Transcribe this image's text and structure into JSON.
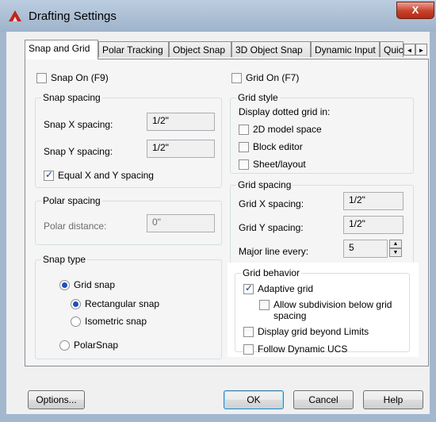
{
  "window": {
    "title": "Drafting Settings",
    "close_glyph": "X",
    "app_icon": "autocad-red-a-icon"
  },
  "tabs": [
    {
      "label": "Snap and Grid"
    },
    {
      "label": "Polar Tracking"
    },
    {
      "label": "Object Snap"
    },
    {
      "label": "3D Object Snap"
    },
    {
      "label": "Dynamic Input"
    },
    {
      "label": "Quic"
    }
  ],
  "tab_scroll": {
    "left": "◄",
    "right": "►"
  },
  "snap_on": {
    "label": "Snap On (F9)",
    "checked": false
  },
  "grid_on": {
    "label": "Grid On (F7)",
    "checked": false
  },
  "snap_spacing": {
    "title": "Snap spacing",
    "x_label": "Snap X spacing:",
    "x_value": "1/2\"",
    "y_label": "Snap Y spacing:",
    "y_value": "1/2\"",
    "equal_label": "Equal X and Y spacing",
    "equal_checked": true
  },
  "polar_spacing": {
    "title": "Polar spacing",
    "distance_label": "Polar distance:",
    "distance_value": "0\""
  },
  "snap_type": {
    "title": "Snap type",
    "grid_snap": "Grid snap",
    "rectangular": "Rectangular snap",
    "isometric": "Isometric snap",
    "polar": "PolarSnap",
    "selected": "Grid snap",
    "grid_mode": "Rectangular snap"
  },
  "grid_style": {
    "title": "Grid style",
    "subtitle": "Display dotted grid in:",
    "model_space": "2D model space",
    "block_editor": "Block editor",
    "sheet_layout": "Sheet/layout"
  },
  "grid_spacing": {
    "title": "Grid spacing",
    "x_label": "Grid X spacing:",
    "x_value": "1/2\"",
    "y_label": "Grid Y spacing:",
    "y_value": "1/2\"",
    "major_label": "Major line every:",
    "major_value": "5"
  },
  "grid_behavior": {
    "title": "Grid behavior",
    "adaptive": "Adaptive grid",
    "adaptive_checked": true,
    "subdivision_line1": "Allow subdivision below grid",
    "subdivision_line2": "spacing",
    "beyond_limits": "Display grid beyond Limits",
    "follow_ucs": "Follow Dynamic UCS"
  },
  "buttons": {
    "options": "Options...",
    "ok": "OK",
    "cancel": "Cancel",
    "help": "Help"
  }
}
